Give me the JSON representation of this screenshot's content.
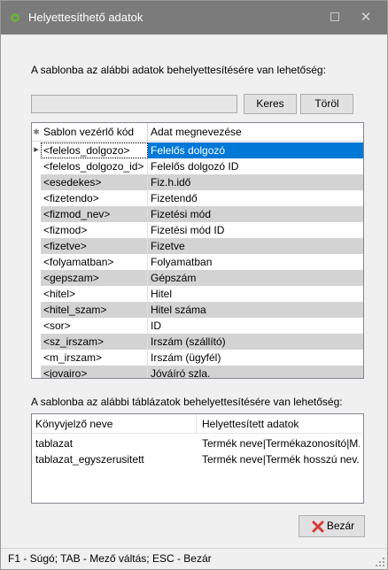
{
  "window": {
    "title": "Helyettesíthető adatok"
  },
  "section1": {
    "label": "A sablonba az alábbi adatok behelyettesítésére van lehetőség:",
    "search_value": "",
    "search_button": "Keres",
    "clear_button": "Töröl"
  },
  "grid": {
    "headers": [
      "Sablon vezérlő kód",
      "Adat megnevezése"
    ],
    "rows": [
      [
        "<felelos_dolgozo>",
        "Felelős dolgozó"
      ],
      [
        "<felelos_dolgozo_id>",
        "Felelős dolgozó ID"
      ],
      [
        "<esedekes>",
        "Fiz.h.idő"
      ],
      [
        "<fizetendo>",
        "Fizetendő"
      ],
      [
        "<fizmod_nev>",
        "Fizetési mód"
      ],
      [
        "<fizmod>",
        "Fizetési mód ID"
      ],
      [
        "<fizetve>",
        "Fizetve"
      ],
      [
        "<folyamatban>",
        "Folyamatban"
      ],
      [
        "<gepszam>",
        "Gépszám"
      ],
      [
        "<hitel>",
        "Hitel"
      ],
      [
        "<hitel_szam>",
        "Hitel száma"
      ],
      [
        "<sor>",
        "ID"
      ],
      [
        "<sz_irszam>",
        "Irszám (szállító)"
      ],
      [
        "<m_irszam>",
        "Irszám (ügyfél)"
      ],
      [
        "<jovairo>",
        "Jóváíró szla."
      ]
    ]
  },
  "section2": {
    "label": "A sablonba az alábbi táblázatok behelyettesítésére van lehetőség:",
    "headers": [
      "Könyvjelző neve",
      "Helyettesített adatok"
    ],
    "rows": [
      [
        "tablazat",
        "Termék neve|Termékazonosító|M..."
      ],
      [
        "tablazat_egyszerusitett",
        "Termék neve|Termék hosszú nev..."
      ]
    ]
  },
  "close_button": "Bezár",
  "status": "F1 - Súgó; TAB - Mező váltás; ESC - Bezár"
}
